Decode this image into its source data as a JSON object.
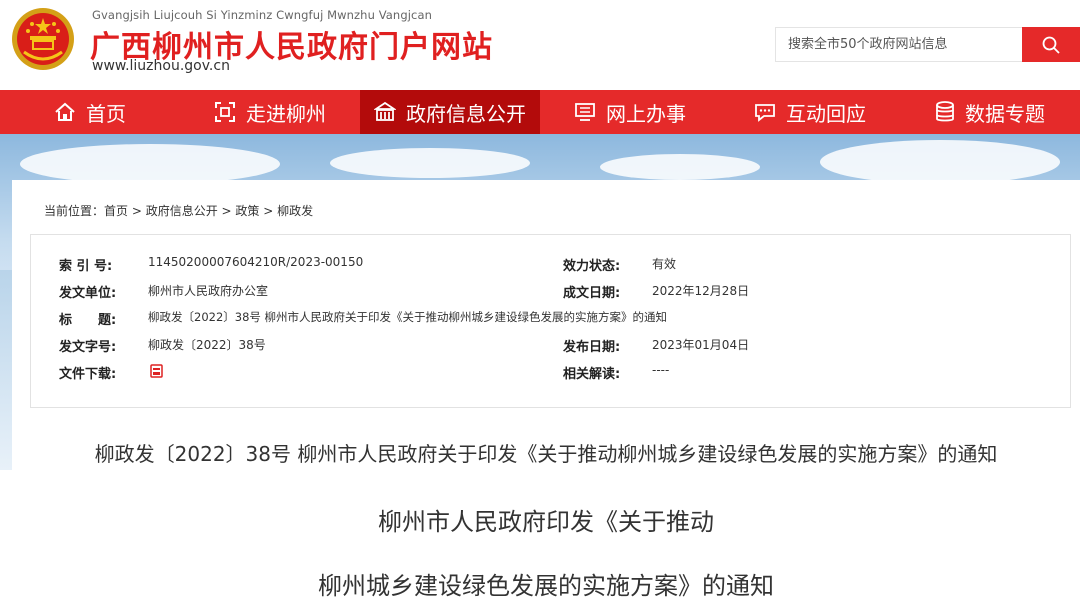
{
  "header": {
    "pinyin": "Gvangjsih Liujcouh Si Yinzminz Cwngfuj Mwnzhu Vangjcan",
    "title": "广西柳州市人民政府门户网站",
    "url": "www.liuzhou.gov.cn",
    "search_placeholder": "搜索全市50个政府网站信息"
  },
  "nav": [
    {
      "label": "首页",
      "icon": "home-icon"
    },
    {
      "label": "走进柳州",
      "icon": "scan-icon"
    },
    {
      "label": "政府信息公开",
      "icon": "building-icon",
      "active": true
    },
    {
      "label": "网上办事",
      "icon": "monitor-icon"
    },
    {
      "label": "互动回应",
      "icon": "chat-icon"
    },
    {
      "label": "数据专题",
      "icon": "database-icon"
    }
  ],
  "breadcrumb": {
    "prefix": "当前位置：",
    "items": [
      "首页",
      "政府信息公开",
      "政策",
      "柳政发"
    ],
    "sep": " > "
  },
  "meta": {
    "index_label": "索 引 号:",
    "index_value": "11450200007604210R/2023-00150",
    "status_label": "效力状态:",
    "status_value": "有效",
    "issuer_label": "发文单位:",
    "issuer_value": "柳州市人民政府办公室",
    "created_label": "成文日期:",
    "created_value": "2022年12月28日",
    "title_label": "标　　题:",
    "title_value": "柳政发〔2022〕38号 柳州市人民政府关于印发《关于推动柳州城乡建设绿色发展的实施方案》的通知",
    "docno_label": "发文字号:",
    "docno_value": "柳政发〔2022〕38号",
    "published_label": "发布日期:",
    "published_value": "2023年01月04日",
    "download_label": "文件下载:",
    "download_icon": "pdf-icon",
    "interp_label": "相关解读:",
    "interp_value": "----"
  },
  "document": {
    "title": "柳政发〔2022〕38号 柳州市人民政府关于印发《关于推动柳州城乡建设绿色发展的实施方案》的通知",
    "heading_line1": "柳州市人民政府印发《关于推动",
    "heading_line2": "柳州城乡建设绿色发展的实施方案》的通知"
  },
  "colors": {
    "brand_red": "#e52a2a",
    "active_nav": "#b30b0b"
  }
}
